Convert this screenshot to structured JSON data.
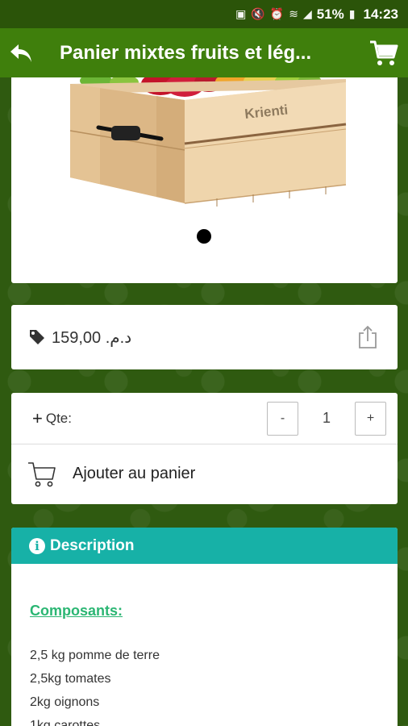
{
  "status_bar": {
    "battery_percent": "51%",
    "time": "14:23"
  },
  "app_bar": {
    "title": "Panier mixtes fruits et lég..."
  },
  "product_image": {
    "brand_text": "Krienti"
  },
  "price": {
    "value": "159,00 .د.م"
  },
  "quantity": {
    "label": "Qte:",
    "value": "1",
    "minus": "-",
    "plus": "+"
  },
  "add_to_cart": {
    "label": "Ajouter au panier"
  },
  "description": {
    "header": "Description",
    "section_title": "Composants:",
    "items": [
      "2,5 kg pomme de terre",
      "2,5kg tomates",
      "2kg oignons",
      "1kg carottes"
    ]
  }
}
